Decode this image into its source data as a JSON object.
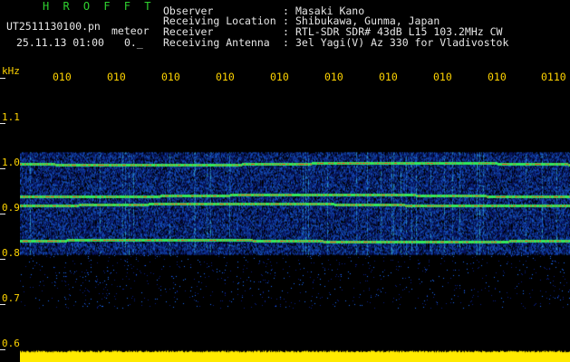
{
  "title": "H R O F F T",
  "file": {
    "name_line": "UT2511130100.pn",
    "name_suffix": "meteor",
    "date_line": "25.11.13 01:00",
    "extra": "0._"
  },
  "header": [
    {
      "key": "Observer",
      "value": "Masaki Kano"
    },
    {
      "key": "Receiving Location",
      "value": "Shibukawa, Gunma, Japan"
    },
    {
      "key": "Receiver",
      "value": "RTL-SDR SDR# 43dB L15 103.2MHz CW"
    },
    {
      "key": "Receiving Antenna",
      "value": "3el Yagi(V) Az 330 for Vladivostok"
    }
  ],
  "x_ticks": [
    "010",
    "010",
    "010",
    "010",
    "010",
    "010",
    "010",
    "010",
    "010",
    "0110"
  ],
  "y_axis": {
    "unit": "kHz",
    "ticks": [
      "1.1",
      "1.0",
      "0.9",
      "0.8",
      "0.7",
      "0.6"
    ],
    "range": [
      0.6,
      1.1
    ]
  },
  "spectrogram": {
    "band_khz": [
      0.81,
      1.035
    ],
    "lines_khz": [
      1.01,
      0.94,
      0.92,
      0.84
    ],
    "colors": {
      "background": "#000000",
      "noise_dark": "#0a1f8a",
      "noise_light": "#1d6cff",
      "cyan": "#3fd6ff",
      "signal_green": "#35e85a",
      "signal_red": "#ff3a1f",
      "level_bar": "#ffea00"
    },
    "level_bar_fill": 0.9
  }
}
